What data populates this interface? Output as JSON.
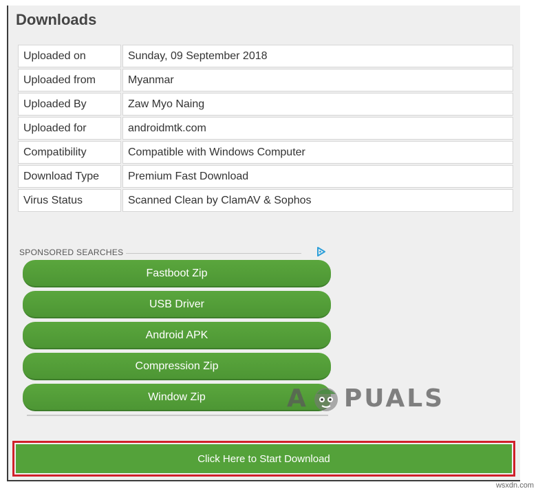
{
  "section": {
    "title": "Downloads"
  },
  "details": {
    "rows": [
      {
        "label": "Uploaded on",
        "value": "Sunday, 09 September 2018"
      },
      {
        "label": "Uploaded from",
        "value": "Myanmar"
      },
      {
        "label": "Uploaded By",
        "value": "Zaw Myo Naing"
      },
      {
        "label": "Uploaded for",
        "value": "androidmtk.com"
      },
      {
        "label": "Compatibility",
        "value": "Compatible with Windows Computer"
      },
      {
        "label": "Download Type",
        "value": "Premium Fast Download"
      },
      {
        "label": "Virus Status",
        "value": "Scanned Clean by ClamAV & Sophos"
      }
    ]
  },
  "sponsored": {
    "heading": "SPONSORED SEARCHES",
    "icon": "adchoices-icon",
    "items": [
      {
        "label": "Fastboot Zip"
      },
      {
        "label": "USB Driver"
      },
      {
        "label": "Android APK"
      },
      {
        "label": "Compression Zip"
      },
      {
        "label": "Window Zip"
      }
    ]
  },
  "watermark": {
    "text_left": "A",
    "text_right": "PUALS"
  },
  "download": {
    "label": "Click Here to Start Download"
  },
  "footer": {
    "credit": "wsxdn.com"
  },
  "colors": {
    "button_green": "#54a23a",
    "highlight_red": "#d0202a",
    "panel_bg": "#efefef"
  }
}
